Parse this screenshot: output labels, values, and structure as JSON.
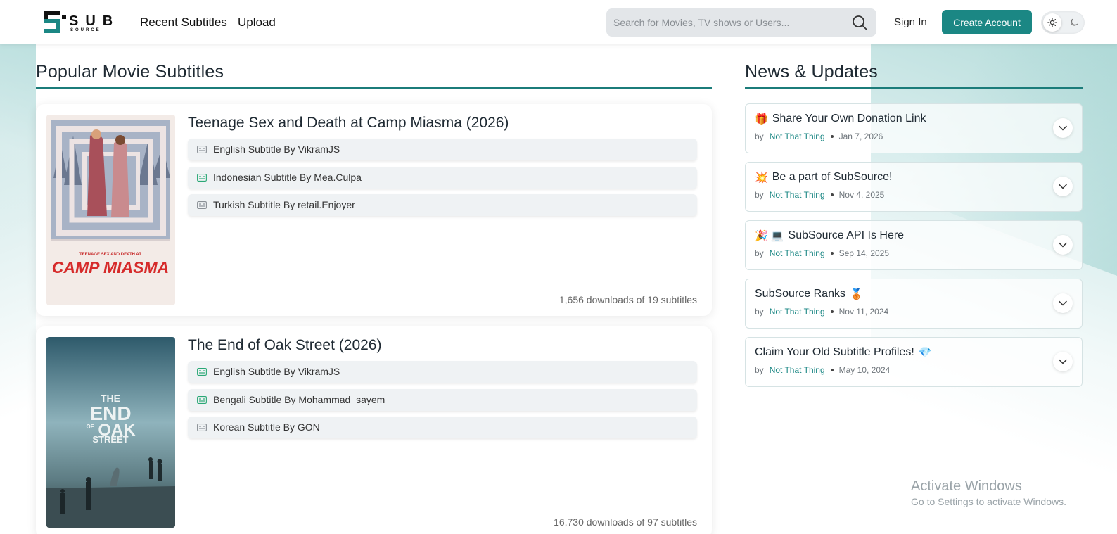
{
  "header": {
    "logo_text": "SUB",
    "logo_subtext": "SOURCE",
    "nav": [
      "Recent Subtitles",
      "Upload"
    ],
    "search_placeholder": "Search for Movies, TV shows or Users...",
    "sign_in": "Sign In",
    "create_account": "Create Account"
  },
  "main": {
    "title": "Popular Movie Subtitles",
    "movies": [
      {
        "title": "Teenage Sex and Death at Camp Miasma (2026)",
        "poster_small_text": "TEENAGE SEX AND DEATH AT",
        "poster_big_text": "CAMP MIASMA",
        "subtitles": [
          {
            "label": "English Subtitle By VikramJS",
            "icon": "cc-gray-icon"
          },
          {
            "label": "Indonesian Subtitle By Mea.Culpa",
            "icon": "cc-green-icon"
          },
          {
            "label": "Turkish Subtitle By retail.Enjoyer",
            "icon": "cc-gray-icon"
          }
        ],
        "downloads": "1,656 downloads of 19 subtitles"
      },
      {
        "title": "The End of Oak Street (2026)",
        "poster_lines": [
          "THE",
          "END",
          "OF",
          "OAK",
          "STREET"
        ],
        "subtitles": [
          {
            "label": "English Subtitle By VikramJS",
            "icon": "cc-green-icon"
          },
          {
            "label": "Bengali Subtitle By Mohammad_sayem",
            "icon": "cc-green-icon"
          },
          {
            "label": "Korean Subtitle By GON",
            "icon": "cc-gray-icon"
          }
        ],
        "downloads": "16,730 downloads of 97 subtitles"
      }
    ]
  },
  "news": {
    "title": "News & Updates",
    "items": [
      {
        "emoji_before": "🎁",
        "title": "Share Your Own Donation Link",
        "emoji_after": "",
        "by": "by",
        "author": "Not That Thing",
        "date": "Jan 7, 2026"
      },
      {
        "emoji_before": "💥",
        "title": "Be a part of SubSource!",
        "emoji_after": "",
        "by": "by",
        "author": "Not That Thing",
        "date": "Nov 4, 2025"
      },
      {
        "emoji_before": "🎉 💻",
        "title": "SubSource API Is Here",
        "emoji_after": "",
        "by": "by",
        "author": "Not That Thing",
        "date": "Sep 14, 2025"
      },
      {
        "emoji_before": "",
        "title": "SubSource Ranks",
        "emoji_after": "🥉",
        "by": "by",
        "author": "Not That Thing",
        "date": "Nov 11, 2024"
      },
      {
        "emoji_before": "",
        "title": "Claim Your Old Subtitle Profiles!",
        "emoji_after": "💎",
        "by": "by",
        "author": "Not That Thing",
        "date": "May 10, 2024"
      }
    ]
  },
  "watermark": {
    "title": "Activate Windows",
    "subtitle": "Go to Settings to activate Windows."
  },
  "colors": {
    "accent": "#1b8784",
    "rule": "#1b7c7a",
    "cc_green": "#2aa876",
    "cc_gray": "#8a9096"
  }
}
